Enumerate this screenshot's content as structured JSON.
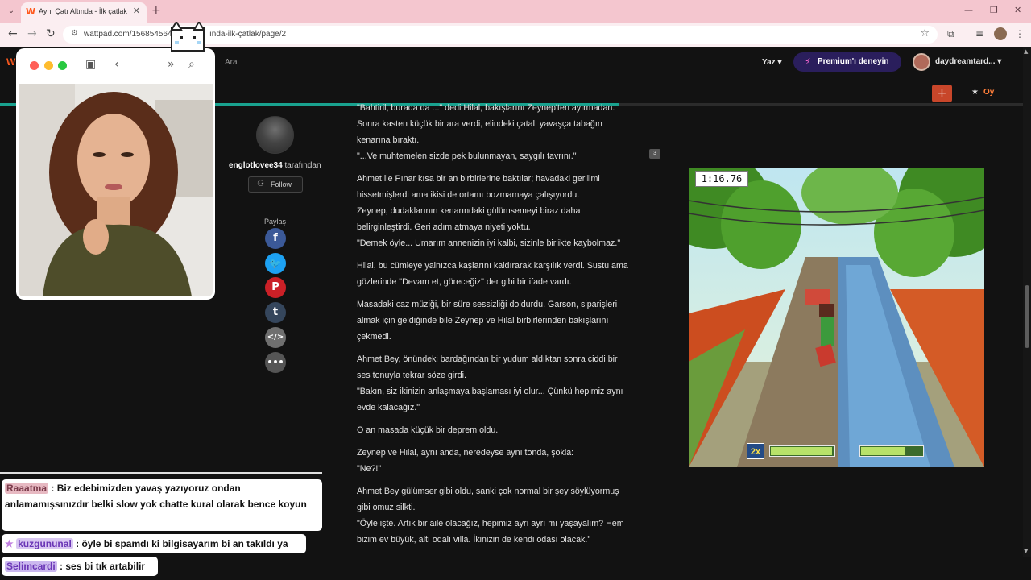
{
  "browser": {
    "tab_title": "Aynı Çatı Altında - İlk çatlak",
    "url": "wattpad.com/1568545642-...ında-ilk-çatlak/page/2",
    "url_visible_left": "wattpad.com/156854564",
    "url_visible_right": "ında-ilk-çatlak/page/2"
  },
  "site": {
    "logo": "W",
    "search_label": "Ara",
    "write_menu": "Yaz ▾",
    "premium_label": "Premium'ı deneyin",
    "username": "daydreamtard... ▾",
    "vote_label": "Oy",
    "reading_progress_pct": 60
  },
  "author": {
    "name": "englotlovee34",
    "suffix": " tarafından",
    "follow_label": "Follow",
    "share_label": "Paylaş"
  },
  "story": {
    "paragraphs": [
      [
        "\"Bahtiril, burada da ...\" dedi Hilal, bakışlarını Zeynep'ten ayırmadan.",
        "Sonra kasten küçük bir ara verdi, elindeki çatalı yavaşça tabağın",
        "kenarına bıraktı.",
        "\"...Ve muhtemelen sizde pek bulunmayan, saygılı tavrını.\""
      ],
      [
        "Ahmet ile Pınar kısa bir an birbirlerine baktılar; havadaki gerilimi",
        "hissetmişlerdi ama ikisi de ortamı bozmamaya çalışıyordu.",
        "Zeynep, dudaklarının kenarındaki gülümsemeyi biraz daha",
        "belirginleştirdi. Geri adım atmaya niyeti yoktu.",
        "\"Demek öyle... Umarım annenizin iyi kalbi, sizinle birlikte kaybolmaz.\""
      ],
      [
        "Hilal, bu cümleye yalnızca kaşlarını kaldırarak karşılık verdi. Sustu ama",
        "gözlerinde \"Devam et, göreceğiz\" der gibi bir ifade vardı."
      ],
      [
        "Masadaki caz müziği, bir süre sessizliği doldurdu. Garson, siparişleri",
        "almak için geldiğinde bile Zeynep ve Hilal birbirlerinden bakışlarını",
        "çekmedi."
      ],
      [
        "Ahmet Bey, önündeki bardağından bir yudum aldıktan sonra ciddi bir",
        "ses tonuyla tekrar söze girdi.",
        "\"Bakın, siz ikinizin anlaşmaya başlaması iyi olur... Çünkü hepimiz aynı",
        "evde kalacağız.\""
      ],
      [
        "O an masada küçük bir deprem oldu."
      ],
      [
        "Zeynep ve Hilal, aynı anda, neredeyse aynı tonda, şokla:",
        "\"Ne?!\""
      ],
      [
        "Ahmet Bey gülümser gibi oldu, sanki çok normal bir şey söylüyormuş",
        "gibi omuz silkti.",
        "\"Öyle işte. Artık bir aile olacağız, hepimiz ayrı ayrı mı yaşayalım? Hem",
        "bizim ev büyük, altı odalı villa. İkinizin de kendi odası olacak.\""
      ]
    ],
    "comment_count": "3"
  },
  "game": {
    "timer": "1:16.76",
    "multiplier": "2x",
    "bar1_fill": 0.95,
    "bar2_fill": 0.7
  },
  "chat": [
    {
      "user": "Raaatma",
      "text": " : Biz edebimizden yavaş yazıyoruz ondan anlamamışsınızdır belki slow yok chatte kural olarak bence koyun",
      "user_bg": "#e7b9c2",
      "user_color": "#7a3a4a"
    },
    {
      "user": "kuzgununal",
      "text": " : öyle bi spamdı ki bilgisayarım bi an takıldı ya",
      "user_bg": "#d9c7f2",
      "user_color": "#6a36b6",
      "badge": "★"
    },
    {
      "user": "Selimcardi",
      "text": " : ses bi tık artabilir",
      "user_bg": "#cbb8ef",
      "user_color": "#6a36b6"
    }
  ],
  "colors": {
    "accent_orange": "#ff5a1f",
    "progress_teal": "#19a28f",
    "premium_bg": "#2a1e5c"
  },
  "icons": {
    "share": [
      "facebook-icon",
      "twitter-icon",
      "pinterest-icon",
      "tumblr-icon",
      "embed-icon",
      "more-icon"
    ]
  }
}
